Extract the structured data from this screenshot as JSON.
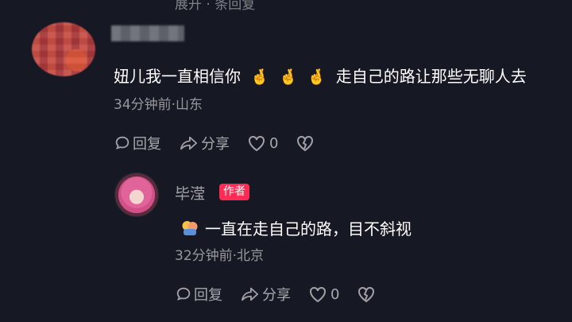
{
  "top_cut_text": "展开 · 条回复",
  "parent_comment": {
    "text": "妞儿我一直相信你",
    "emoji": "🤞",
    "text_after": "走自己的路让那些无聊人去",
    "meta": "34分钟前·山东",
    "actions": {
      "reply_label": "回复",
      "share_label": "分享",
      "like_count": "0"
    }
  },
  "reply_comment": {
    "username": "毕滢",
    "badge": "作者",
    "text": "一直在走自己的路，目不斜视",
    "meta": "32分钟前·北京",
    "actions": {
      "reply_label": "回复",
      "share_label": "分享",
      "like_count": "0"
    }
  },
  "colors": {
    "background": "#161823",
    "author_badge": "#fe2c55",
    "secondary_text": "#9b9ba2"
  },
  "icons": [
    "comment-bubble-icon",
    "share-arrow-icon",
    "heart-icon",
    "broken-heart-icon",
    "hug-emoji-icon",
    "crossed-fingers-emoji-icon"
  ]
}
